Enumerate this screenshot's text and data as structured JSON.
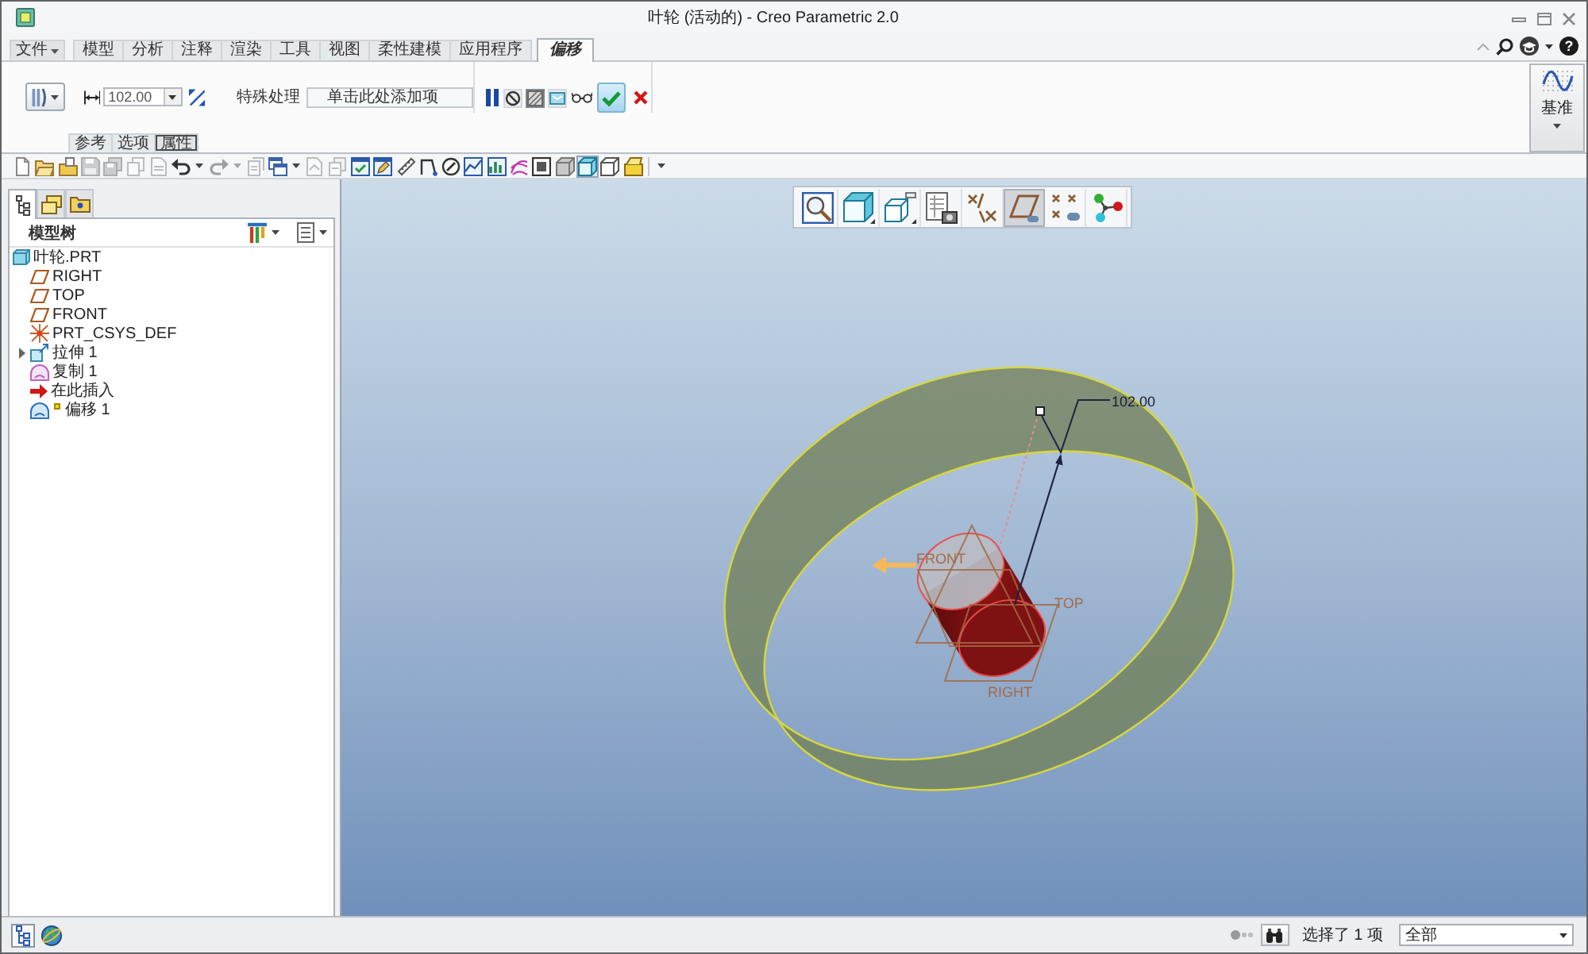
{
  "window": {
    "title": "叶轮 (活动的) - Creo Parametric 2.0"
  },
  "ribbon": {
    "tabs": [
      {
        "label": "文件",
        "kind": "menu",
        "selected": false
      },
      {
        "label": "模型",
        "kind": "tab",
        "selected": false
      },
      {
        "label": "分析",
        "kind": "tab",
        "selected": false
      },
      {
        "label": "注释",
        "kind": "tab",
        "selected": false
      },
      {
        "label": "渲染",
        "kind": "tab",
        "selected": false
      },
      {
        "label": "工具",
        "kind": "tab",
        "selected": false
      },
      {
        "label": "视图",
        "kind": "tab",
        "selected": false
      },
      {
        "label": "柔性建模",
        "kind": "tab",
        "selected": false
      },
      {
        "label": "应用程序",
        "kind": "tab",
        "selected": false
      },
      {
        "label": "偏移",
        "kind": "tab",
        "selected": true
      }
    ],
    "help": "?",
    "offset_tab": {
      "distance": "102.00",
      "special_handling": {
        "label": "特殊处理",
        "placeholder": "单击此处添加项"
      },
      "preview_modes": [
        {
          "selected": false
        },
        {
          "selected": true
        },
        {
          "selected": false
        }
      ],
      "panels": [
        {
          "label": "参考",
          "selected": false
        },
        {
          "label": "选项",
          "selected": false
        },
        {
          "label": "属性",
          "selected": true
        }
      ]
    },
    "datum_button": {
      "label": "基准"
    }
  },
  "quick_toolbar": [
    {
      "kind": "button",
      "disabled": false
    },
    {
      "kind": "button",
      "disabled": false
    },
    {
      "kind": "button",
      "disabled": false
    },
    {
      "kind": "button",
      "disabled": true
    },
    {
      "kind": "button",
      "disabled": true
    },
    {
      "kind": "button",
      "disabled": true
    },
    {
      "kind": "button",
      "disabled": true
    },
    {
      "kind": "button",
      "disabled": false
    },
    {
      "kind": "caret",
      "disabled": false
    },
    {
      "kind": "button",
      "disabled": true
    },
    {
      "kind": "caret",
      "disabled": true
    },
    {
      "kind": "button",
      "disabled": true
    },
    {
      "kind": "button",
      "disabled": false
    },
    {
      "kind": "caret",
      "disabled": false
    },
    {
      "kind": "button",
      "disabled": true
    },
    {
      "kind": "button",
      "disabled": true
    },
    {
      "kind": "button",
      "disabled": false
    },
    {
      "kind": "button",
      "disabled": false
    },
    {
      "kind": "button",
      "disabled": false
    },
    {
      "kind": "button",
      "disabled": false
    },
    {
      "kind": "button",
      "disabled": false
    },
    {
      "kind": "button",
      "disabled": false
    },
    {
      "kind": "button",
      "disabled": false
    },
    {
      "kind": "button",
      "disabled": false
    },
    {
      "kind": "button",
      "disabled": false
    },
    {
      "kind": "toggle",
      "disabled": false,
      "selected": false
    },
    {
      "kind": "toggle",
      "disabled": false,
      "selected": true
    },
    {
      "kind": "toggle",
      "disabled": false,
      "selected": false
    },
    {
      "kind": "button",
      "disabled": false
    },
    {
      "kind": "caret",
      "disabled": false
    }
  ],
  "model_tree": {
    "tabs": [
      {
        "selected": true
      },
      {
        "selected": false
      },
      {
        "selected": false
      }
    ],
    "title": "模型树",
    "items": [
      {
        "label": "叶轮.PRT",
        "kind": "part",
        "children": [
          {
            "label": "RIGHT",
            "kind": "plane",
            "editing": false
          },
          {
            "label": "TOP",
            "kind": "plane",
            "editing": false
          },
          {
            "label": "FRONT",
            "kind": "plane",
            "editing": false
          },
          {
            "label": "PRT_CSYS_DEF",
            "kind": "csys",
            "editing": false
          },
          {
            "label": "拉伸 1",
            "kind": "extrude",
            "expanded": false,
            "editing": false
          },
          {
            "label": "复制 1",
            "kind": "copy",
            "editing": false
          },
          {
            "label": "在此插入",
            "kind": "insert",
            "editing": false
          },
          {
            "label": "偏移 1",
            "kind": "offset",
            "editing": true
          }
        ]
      }
    ]
  },
  "graphics": {
    "datum_display": [
      {
        "on": false
      },
      {
        "on": true
      },
      {
        "on": false
      },
      {
        "on": false
      }
    ],
    "dimension": "102.00",
    "datum_labels": [
      "FRONT",
      "TOP",
      "RIGHT"
    ]
  },
  "status_bar": {
    "toggles": [
      {
        "on": true
      },
      {
        "on": false
      }
    ],
    "selection": "选择了 1 项",
    "filter": "全部"
  }
}
